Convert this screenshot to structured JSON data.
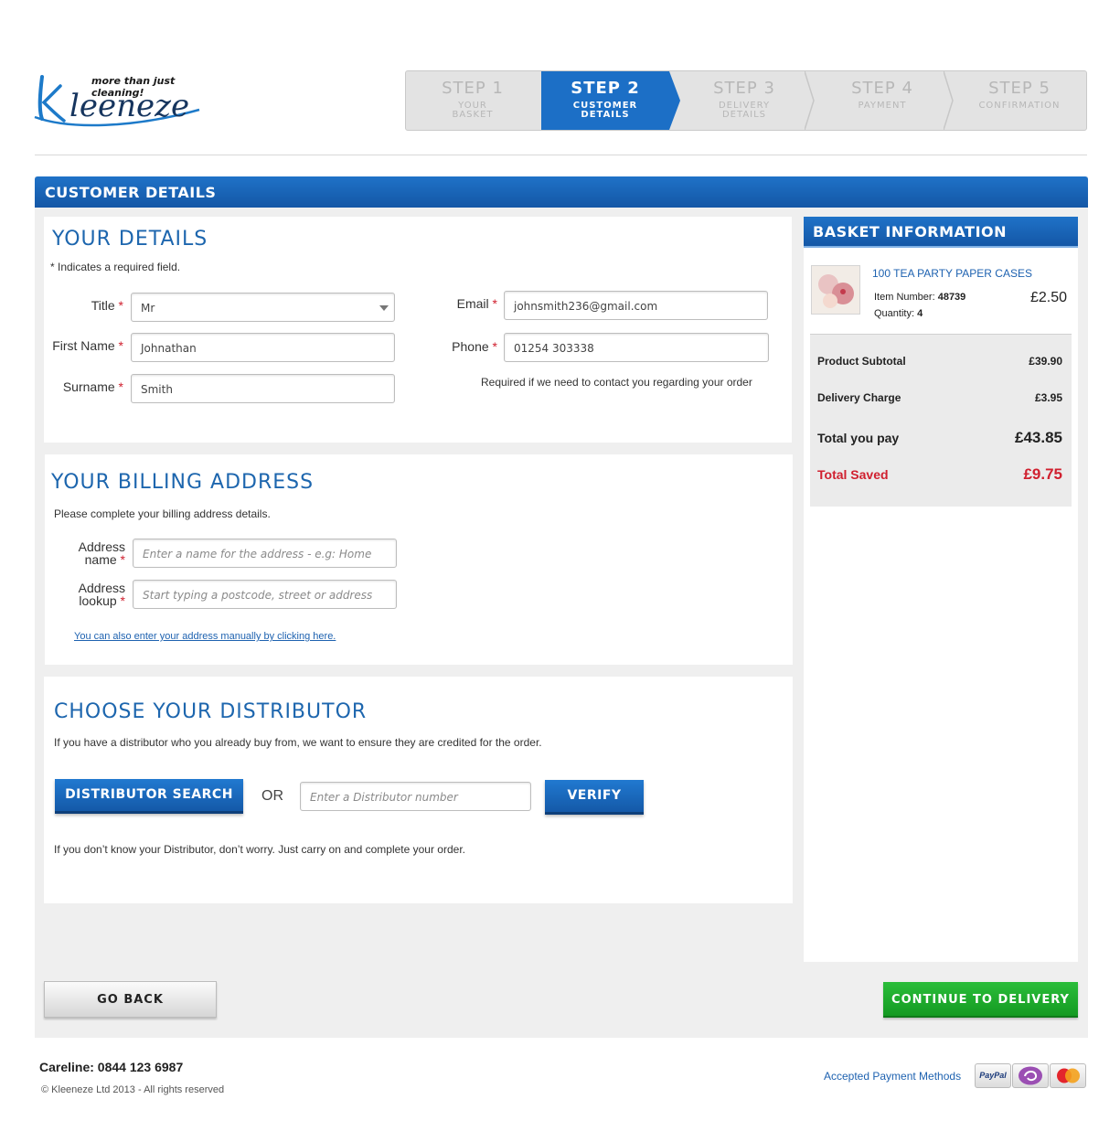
{
  "brand": {
    "name": "Kleeneze",
    "tagline": "more than just cleaning!"
  },
  "steps": [
    {
      "number": "STEP 1",
      "label": "YOUR\nBASKET",
      "active": false
    },
    {
      "number": "STEP 2",
      "label": "CUSTOMER\nDETAILS",
      "active": true
    },
    {
      "number": "STEP 3",
      "label": "DELIVERY\nDETAILS",
      "active": false
    },
    {
      "number": "STEP 4",
      "label": "PAYMENT",
      "active": false
    },
    {
      "number": "STEP 5",
      "label": "CONFIRMATION",
      "active": false
    }
  ],
  "page_title": "CUSTOMER DETAILS",
  "your_details": {
    "heading": "YOUR DETAILS",
    "required_note": "* Indicates a required field.",
    "title_label": "Title",
    "title_value": "Mr",
    "first_name_label": "First Name",
    "first_name_value": "Johnathan",
    "surname_label": "Surname",
    "surname_value": "Smith",
    "email_label": "Email",
    "email_value": "johnsmith236@gmail.com",
    "phone_label": "Phone",
    "phone_value": "01254 303338",
    "phone_note": "Required if we need to contact you regarding your order",
    "required_marker": "*"
  },
  "billing": {
    "heading": "YOUR BILLING ADDRESS",
    "intro": "Please complete your billing address details.",
    "address_name_label_1": "Address",
    "address_name_label_2": "name",
    "address_name_placeholder": "Enter a name for the address - e.g: Home",
    "address_lookup_label_1": "Address",
    "address_lookup_label_2": "lookup",
    "address_lookup_placeholder": "Start typing a postcode, street or address",
    "manual_link": "You can also enter your address manually by clicking here."
  },
  "distributor": {
    "heading": "CHOOSE YOUR DISTRIBUTOR",
    "intro": "If you have a distributor who you already buy from, we want to ensure they are credited for the order.",
    "search_button": "DISTRIBUTOR SEARCH",
    "or_text": "OR",
    "number_placeholder": "Enter a Distributor number",
    "verify_button": "VERIFY",
    "note": "If you don’t know your Distributor, don’t worry. Just carry on and complete your order."
  },
  "basket": {
    "heading": "BASKET INFORMATION",
    "product_name": "100 TEA PARTY PAPER CASES",
    "item_number_label": "Item Number:",
    "item_number": "48739",
    "quantity_label": "Quantity:",
    "quantity": "4",
    "price": "£2.50",
    "subtotal_label": "Product Subtotal",
    "subtotal": "£39.90",
    "delivery_label": "Delivery Charge",
    "delivery": "£3.95",
    "total_label": "Total you pay",
    "total": "£43.85",
    "saved_label": "Total Saved",
    "saved": "£9.75"
  },
  "actions": {
    "back": "GO BACK",
    "continue": "CONTINUE TO DELIVERY"
  },
  "footer": {
    "careline": "Careline: 0844 123 6987",
    "copyright": "© Kleeneze Ltd 2013 - All rights reserved",
    "payment_label": "Accepted Payment Methods",
    "payment_methods": [
      "PayPal",
      "Maestro",
      "MasterCard"
    ]
  },
  "colors": {
    "primary_blue": "#1c6fc6",
    "heading_blue": "#1d66ae",
    "continue_green": "#1fae2e",
    "saved_red": "#d0202f"
  }
}
